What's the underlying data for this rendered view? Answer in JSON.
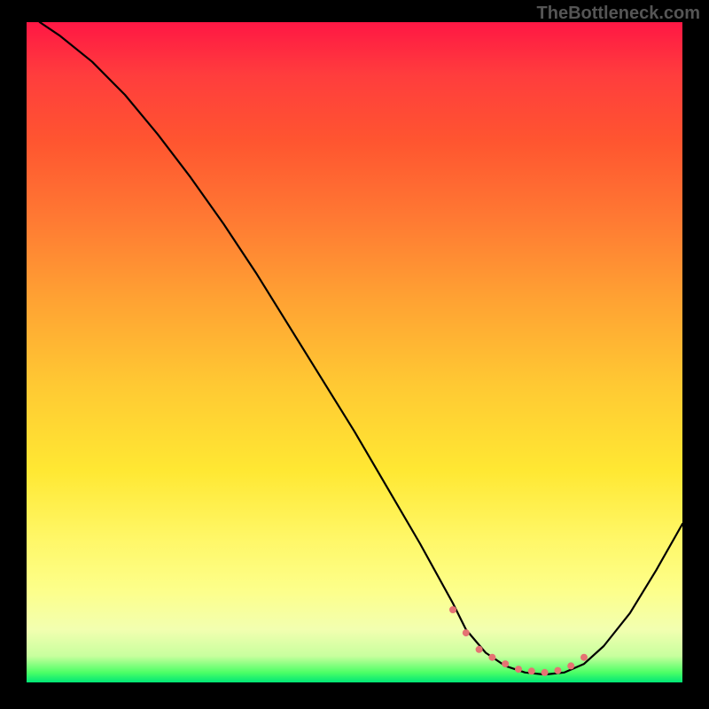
{
  "watermark": "TheBottleneck.com",
  "chart_data": {
    "type": "line",
    "title": "",
    "xlabel": "",
    "ylabel": "",
    "xlim": [
      0,
      100
    ],
    "ylim": [
      0,
      100
    ],
    "gradient_stops": [
      {
        "pos": 0,
        "color": "#ff1744"
      },
      {
        "pos": 8,
        "color": "#ff3d3d"
      },
      {
        "pos": 18,
        "color": "#ff5530"
      },
      {
        "pos": 30,
        "color": "#ff7a33"
      },
      {
        "pos": 42,
        "color": "#ffa233"
      },
      {
        "pos": 55,
        "color": "#ffc933"
      },
      {
        "pos": 68,
        "color": "#ffe833"
      },
      {
        "pos": 78,
        "color": "#fff766"
      },
      {
        "pos": 86,
        "color": "#fdff8a"
      },
      {
        "pos": 92,
        "color": "#f2ffb0"
      },
      {
        "pos": 96,
        "color": "#c8ff9e"
      },
      {
        "pos": 98.5,
        "color": "#4cff66"
      },
      {
        "pos": 100,
        "color": "#00e676"
      }
    ],
    "series": [
      {
        "name": "bottleneck-curve",
        "x": [
          2,
          5,
          10,
          15,
          20,
          25,
          30,
          35,
          40,
          45,
          50,
          55,
          60,
          65,
          67,
          70,
          73,
          76,
          79,
          82,
          85,
          88,
          92,
          96,
          100
        ],
        "y": [
          100,
          98,
          94,
          89,
          83,
          76.5,
          69.5,
          62,
          54,
          46,
          38,
          29.5,
          21,
          12,
          8,
          4.5,
          2.5,
          1.5,
          1.2,
          1.5,
          2.8,
          5.5,
          10.5,
          17,
          24
        ]
      }
    ],
    "markers": {
      "x": [
        65,
        67,
        69,
        71,
        73,
        75,
        77,
        79,
        81,
        83,
        85
      ],
      "y": [
        11,
        7.5,
        5,
        3.8,
        2.8,
        2,
        1.7,
        1.5,
        1.8,
        2.5,
        3.8
      ],
      "color": "#e57373",
      "radius": 4
    }
  }
}
